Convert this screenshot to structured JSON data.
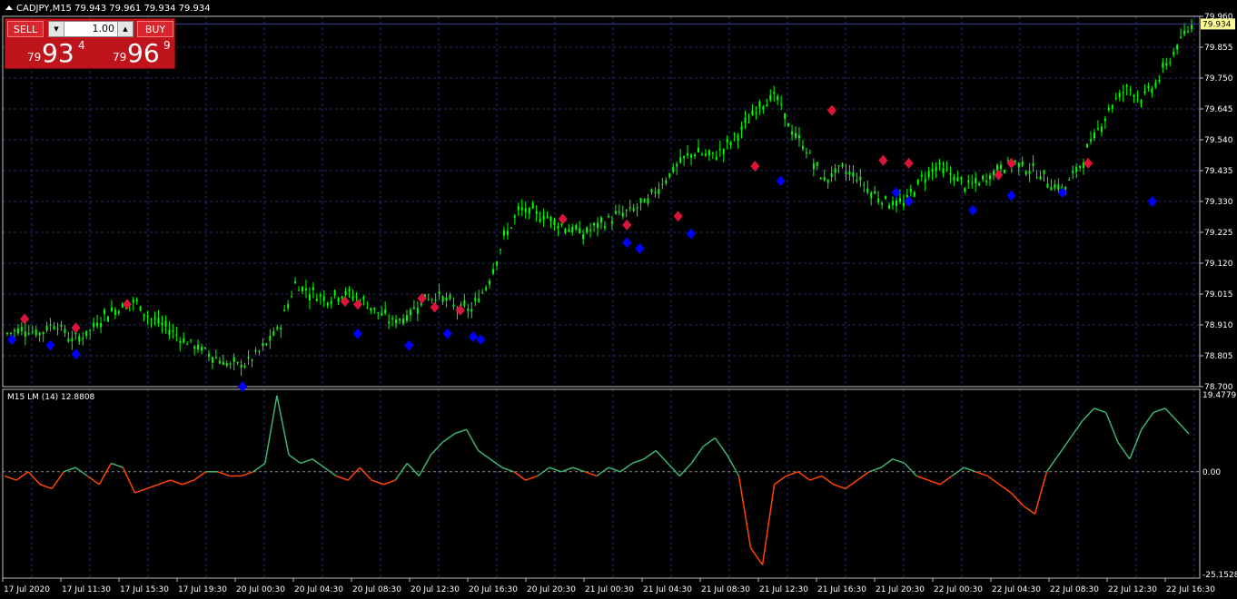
{
  "header": {
    "title": "CADJPY,M15  79.943 79.961 79.934 79.934"
  },
  "trade_panel": {
    "sell_label": "SELL",
    "buy_label": "BUY",
    "lot_value": "1.00",
    "sell_price": {
      "prefix": "79",
      "big": "93",
      "sup": "4"
    },
    "buy_price": {
      "prefix": "79",
      "big": "96",
      "sup": "9"
    }
  },
  "indicator": {
    "label": "M15 LM (14) 12.8808"
  },
  "colors": {
    "bull_candle": "#00ff00",
    "grid": "#1e2a7a",
    "axis": "#c0c0c0",
    "indicator_up": "#3cb371",
    "indicator_down": "#ff4500",
    "sell_signal": "#dc143c",
    "buy_signal": "#0000ff",
    "price_tag_bg": "#ffff99"
  },
  "chart_data": [
    {
      "type": "candlestick",
      "symbol": "CADJPY",
      "timeframe": "M15",
      "ylim": [
        78.7,
        79.96
      ],
      "y_ticks": [
        "79.960",
        "79.855",
        "79.750",
        "79.645",
        "79.540",
        "79.435",
        "79.330",
        "79.225",
        "79.120",
        "79.015",
        "78.910",
        "78.805",
        "78.700"
      ],
      "current_price": "79.934",
      "x_ticks": [
        "17 Jul 2020",
        "17 Jul 11:30",
        "17 Jul 15:30",
        "17 Jul 19:30",
        "20 Jul 00:30",
        "20 Jul 04:30",
        "20 Jul 08:30",
        "20 Jul 12:30",
        "20 Jul 16:30",
        "20 Jul 20:30",
        "21 Jul 00:30",
        "21 Jul 04:30",
        "21 Jul 08:30",
        "21 Jul 12:30",
        "21 Jul 16:30",
        "21 Jul 20:30",
        "22 Jul 00:30",
        "22 Jul 04:30",
        "22 Jul 08:30",
        "22 Jul 12:30",
        "22 Jul 16:30"
      ],
      "close_path": [
        [
          0,
          78.88
        ],
        [
          1,
          78.9
        ],
        [
          2,
          78.88
        ],
        [
          3,
          78.92
        ],
        [
          4,
          78.86
        ],
        [
          5,
          78.88
        ],
        [
          6,
          78.94
        ],
        [
          7,
          78.97
        ],
        [
          8,
          78.99
        ],
        [
          9,
          78.93
        ],
        [
          10,
          78.9
        ],
        [
          11,
          78.86
        ],
        [
          12,
          78.83
        ],
        [
          13,
          78.8
        ],
        [
          14,
          78.77
        ],
        [
          15,
          78.78
        ],
        [
          16,
          78.83
        ],
        [
          17,
          78.9
        ],
        [
          18,
          79.05
        ],
        [
          19,
          79.02
        ],
        [
          20,
          79.0
        ],
        [
          21,
          79.02
        ],
        [
          22,
          79.0
        ],
        [
          23,
          78.96
        ],
        [
          24,
          78.92
        ],
        [
          25,
          78.94
        ],
        [
          26,
          79.0
        ],
        [
          27,
          79.01
        ],
        [
          28,
          78.97
        ],
        [
          29,
          78.96
        ],
        [
          30,
          79.05
        ],
        [
          31,
          79.2
        ],
        [
          32,
          79.3
        ],
        [
          33,
          79.29
        ],
        [
          34,
          79.27
        ],
        [
          35,
          79.24
        ],
        [
          36,
          79.22
        ],
        [
          37,
          79.25
        ],
        [
          38,
          79.28
        ],
        [
          39,
          79.3
        ],
        [
          40,
          79.33
        ],
        [
          41,
          79.4
        ],
        [
          42,
          79.46
        ],
        [
          43,
          79.5
        ],
        [
          44,
          79.48
        ],
        [
          45,
          79.52
        ],
        [
          46,
          79.58
        ],
        [
          47,
          79.66
        ],
        [
          48,
          79.69
        ],
        [
          49,
          79.57
        ],
        [
          50,
          79.5
        ],
        [
          51,
          79.4
        ],
        [
          52,
          79.44
        ],
        [
          53,
          79.42
        ],
        [
          54,
          79.36
        ],
        [
          55,
          79.33
        ],
        [
          56,
          79.32
        ],
        [
          57,
          79.4
        ],
        [
          58,
          79.45
        ],
        [
          59,
          79.42
        ],
        [
          60,
          79.38
        ],
        [
          61,
          79.4
        ],
        [
          62,
          79.45
        ],
        [
          63,
          79.46
        ],
        [
          64,
          79.44
        ],
        [
          65,
          79.4
        ],
        [
          66,
          79.37
        ],
        [
          67,
          79.45
        ],
        [
          68,
          79.56
        ],
        [
          69,
          79.66
        ],
        [
          70,
          79.72
        ],
        [
          71,
          79.68
        ],
        [
          72,
          79.75
        ],
        [
          73,
          79.85
        ],
        [
          74,
          79.93
        ]
      ],
      "sell_signals": [
        [
          1,
          78.93
        ],
        [
          5,
          78.9
        ],
        [
          9,
          78.98
        ],
        [
          26,
          78.99
        ],
        [
          27,
          78.98
        ],
        [
          32,
          79.0
        ],
        [
          33,
          78.97
        ],
        [
          35,
          78.96
        ],
        [
          43,
          79.27
        ],
        [
          48,
          79.25
        ],
        [
          52,
          79.28
        ],
        [
          58,
          79.45
        ],
        [
          64,
          79.64
        ],
        [
          68,
          79.47
        ],
        [
          70,
          79.46
        ],
        [
          77,
          79.42
        ],
        [
          78,
          79.46
        ],
        [
          84,
          79.46
        ]
      ],
      "buy_signals": [
        [
          0,
          78.86
        ],
        [
          3,
          78.84
        ],
        [
          5,
          78.81
        ],
        [
          27,
          78.88
        ],
        [
          31,
          78.84
        ],
        [
          34,
          78.88
        ],
        [
          36,
          78.87
        ],
        [
          36.6,
          78.86
        ],
        [
          48,
          79.19
        ],
        [
          49,
          79.17
        ],
        [
          53,
          79.22
        ],
        [
          60,
          79.4
        ],
        [
          69,
          79.36
        ],
        [
          70,
          79.33
        ],
        [
          75,
          79.3
        ],
        [
          78,
          79.35
        ],
        [
          82,
          79.36
        ],
        [
          89,
          79.33
        ],
        [
          18,
          78.7
        ]
      ]
    },
    {
      "type": "line",
      "name": "M15 LM (14)",
      "ylim": [
        -25.1528,
        19.4779
      ],
      "y_ticks": [
        "19.4779",
        "0.00",
        "-25.1528"
      ],
      "zero_level": 0,
      "values": [
        -1,
        -2,
        0,
        -3,
        -4,
        0,
        1,
        -1,
        -3,
        2,
        1,
        -5,
        -4,
        -3,
        -2,
        -3,
        -2,
        0,
        0,
        -1,
        -1,
        0,
        2,
        18,
        4,
        2,
        3,
        1,
        -1,
        -2,
        1,
        -2,
        -3,
        -2,
        2,
        -1,
        4,
        7,
        9,
        10,
        5,
        3,
        1,
        0,
        -2,
        -1,
        1,
        0,
        1,
        0,
        -1,
        1,
        0,
        2,
        3,
        5,
        2,
        -1,
        2,
        6,
        8,
        4,
        -1,
        -18,
        -22,
        -3,
        -1,
        0,
        -2,
        -1,
        -3,
        -4,
        -2,
        0,
        1,
        3,
        2,
        -1,
        -2,
        -3,
        -1,
        1,
        0,
        -1,
        -3,
        -5,
        -8,
        -10,
        0,
        4,
        8,
        12,
        15,
        14,
        7,
        3,
        10,
        14,
        15,
        12,
        9
      ]
    }
  ]
}
